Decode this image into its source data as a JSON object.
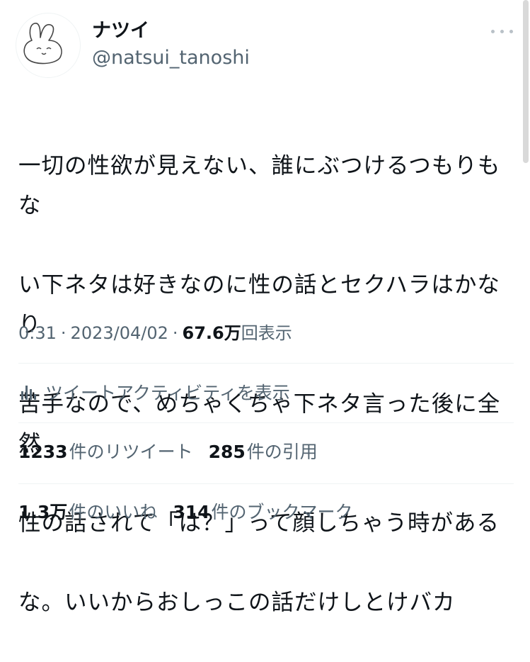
{
  "author": {
    "display_name": "ナツイ",
    "handle": "@natsui_tanoshi",
    "avatar_icon": "rabbit-doodle-icon"
  },
  "tweet": {
    "text": "一切の性欲が見えない、誰にぶつけるつもりもない下ネタは好きなのに性の話とセクハラはかなり苦手なので、めちゃくちゃ下ネタ言った後に全然性の話されて「は？」って顔しちゃう時がある な。いいからおしっこの話だけしとけバカ",
    "lines": [
      "一切の性欲が見えない、誰にぶつけるつもりもな",
      "い下ネタは好きなのに性の話とセクハラはかなり",
      "苦手なので、めちゃくちゃ下ネタ言った後に全然",
      "性の話されて「は？」って顔しちゃう時がある",
      "な。いいからおしっこの話だけしとけバカ"
    ]
  },
  "meta": {
    "time": "0:31",
    "separator": "·",
    "date": "2023/04/02",
    "views_count": "67.6",
    "views_unit": "万",
    "views_label": "回表示"
  },
  "activity": {
    "label": "ツイートアクティビティを表示",
    "icon": "analytics-bar-icon"
  },
  "stats": {
    "retweets_count": "1233",
    "retweets_label": "件のリツイート",
    "quotes_count": "285",
    "quotes_label": "件の引用",
    "likes_count": "1.3",
    "likes_unit": "万",
    "likes_label": "件のいいね",
    "bookmarks_count": "314",
    "bookmarks_label": "件のブックマーク"
  },
  "colors": {
    "text_primary": "#0f1419",
    "text_secondary": "#536471",
    "divider": "#eff3f4"
  }
}
